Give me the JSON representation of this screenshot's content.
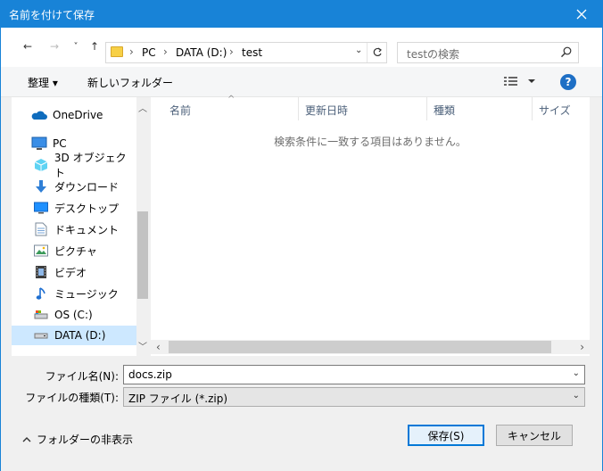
{
  "window": {
    "title": "名前を付けて保存",
    "close_icon": "close-icon"
  },
  "nav": {
    "back": "←",
    "forward": "→",
    "recent": "˅",
    "up": "↑",
    "address": {
      "crumbs": [
        "PC",
        "DATA (D:)",
        "test"
      ],
      "separator": "›"
    },
    "search_placeholder": "testの検索"
  },
  "toolbar": {
    "organize": "整理 ▾",
    "new_folder": "新しいフォルダー"
  },
  "sidebar": {
    "items": [
      {
        "label": "OneDrive",
        "icon": "onedrive-icon"
      },
      {
        "label": "PC",
        "icon": "pc-icon"
      },
      {
        "label": "3D オブジェクト",
        "icon": "3d-objects-icon"
      },
      {
        "label": "ダウンロード",
        "icon": "download-icon"
      },
      {
        "label": "デスクトップ",
        "icon": "desktop-icon"
      },
      {
        "label": "ドキュメント",
        "icon": "documents-icon"
      },
      {
        "label": "ピクチャ",
        "icon": "pictures-icon"
      },
      {
        "label": "ビデオ",
        "icon": "videos-icon"
      },
      {
        "label": "ミュージック",
        "icon": "music-icon"
      },
      {
        "label": "OS (C:)",
        "icon": "drive-icon"
      },
      {
        "label": "DATA (D:)",
        "icon": "drive-icon",
        "selected": true
      }
    ]
  },
  "columns": [
    "名前",
    "更新日時",
    "種類",
    "サイズ"
  ],
  "empty_message": "検索条件に一致する項目はありません。",
  "form": {
    "filename_label": "ファイル名(N):",
    "filename_value": "docs.zip",
    "filetype_label": "ファイルの種類(T):",
    "filetype_value": "ZIP ファイル (*.zip)",
    "hide_folders": "フォルダーの非表示",
    "save": "保存(S)",
    "cancel": "キャンセル"
  },
  "colors": {
    "accent": "#1883d7",
    "selected": "#cde8ff",
    "help": "#1e6fc5"
  }
}
